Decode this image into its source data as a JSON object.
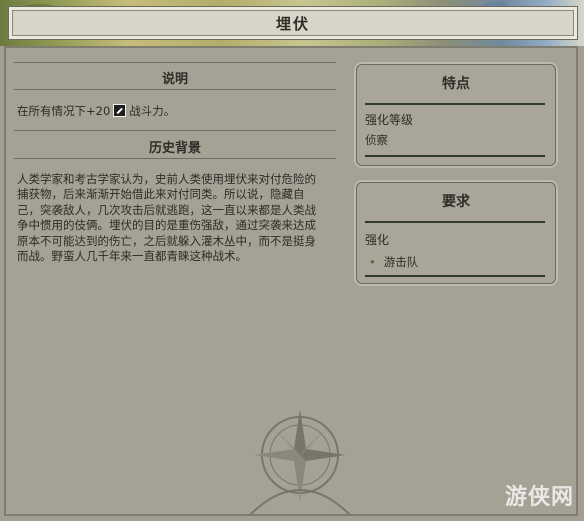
{
  "window": {
    "title": "埋伏"
  },
  "description": {
    "header": "说明",
    "line_prefix": "在所有情况下+20",
    "line_icon": "combat-strength-icon",
    "line_suffix": "战斗力。"
  },
  "history": {
    "header": "历史背景",
    "lines": [
      "人类学家和考古学家认为，史前人类使用埋伏来对付危险的",
      "捕获物，后来渐渐开始借此来对付同类。所以说，隐藏自",
      "己，突袭敌人，几次攻击后就逃跑，这一直以来都是人类战",
      "争中惯用的伎俩。埋伏的目的是重伤强敌，通过突袭来达成",
      "原本不可能达到的伤亡，之后就躲入灌木丛中，而不是挺身",
      "而战。野蛮人几千年来一直都青睐这种战术。"
    ]
  },
  "traits": {
    "header": "特点",
    "label": "强化等级",
    "value": "侦察"
  },
  "requirements": {
    "header": "要求",
    "label": "强化",
    "bullet": "•",
    "item": "游击队"
  },
  "watermark": "游侠网"
}
